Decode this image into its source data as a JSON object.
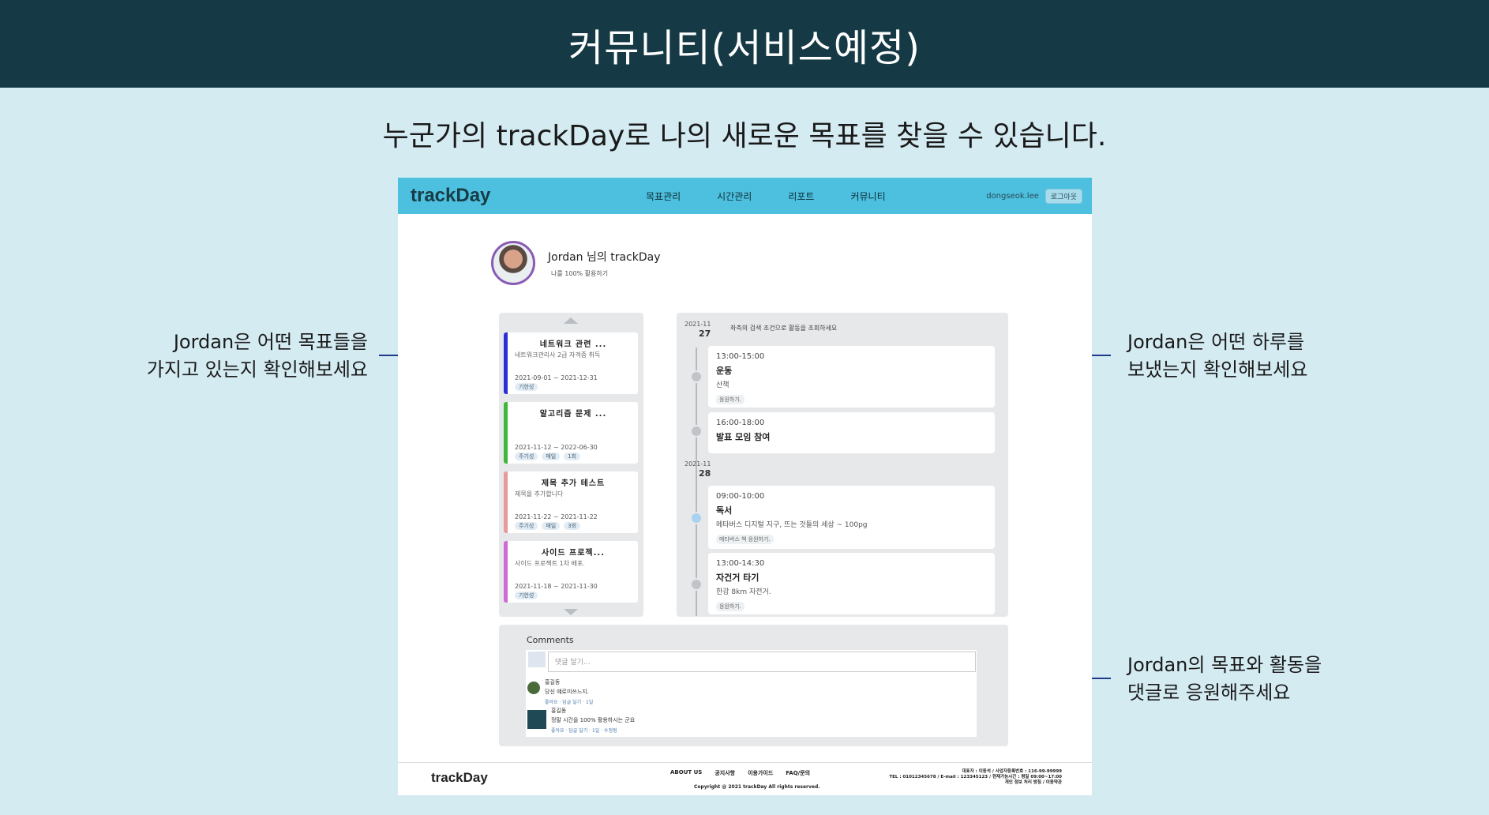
{
  "banner": {
    "title": "커뮤니티(서비스예정)"
  },
  "subtitle": "누군가의 trackDay로 나의 새로운 목표를 찾을 수 있습니다.",
  "annotations": {
    "goals": [
      "Jordan은 어떤 목표들을",
      "가지고 있는지 확인해보세요"
    ],
    "day": [
      "Jordan은 어떤 하루를",
      "보냈는지 확인해보세요"
    ],
    "comments": [
      "Jordan의 목표와 활동을",
      "댓글로 응원해주세요"
    ]
  },
  "app": {
    "logo": "trackDay",
    "menu": [
      "목표관리",
      "시간관리",
      "리포트",
      "커뮤니티"
    ],
    "username": "dongseok.lee",
    "logout": "로그아웃",
    "profile": {
      "name": "Jordan 님의 trackDay",
      "tagline": "나를 100% 활용하기"
    },
    "goals": [
      {
        "title": "네트워크 관련 ...",
        "desc": "네트워크관리사 2급 자격증 취득",
        "date": "2021-09-01 ~ 2021-12-31",
        "tags": [
          "기한성"
        ],
        "color": "#2d2fd6"
      },
      {
        "title": "알고리즘 문제 ...",
        "desc": "",
        "date": "2021-11-12 ~ 2022-06-30",
        "tags": [
          "주기성",
          "매일",
          "1회"
        ],
        "color": "#3fb83a"
      },
      {
        "title": "제목 추가 테스트",
        "desc": "제목을 추가합니다",
        "date": "2021-11-22 ~ 2021-11-22",
        "tags": [
          "주기성",
          "매일",
          "3회"
        ],
        "color": "#e89a9a"
      },
      {
        "title": "사이드 프로젝...",
        "desc": "사이드 프로젝트 1차 배포.",
        "date": "2021-11-18 ~ 2021-11-30",
        "tags": [
          "기한성"
        ],
        "color": "#d06ad4"
      }
    ],
    "timeline": {
      "hint": "좌측의 검색 조건으로 활동을 조회하세요",
      "days": [
        {
          "month": "2021-11",
          "day": "27"
        },
        {
          "month": "2021-11",
          "day": "28"
        }
      ],
      "entries": [
        {
          "time": "13:00-15:00",
          "title": "운동",
          "desc": "산책",
          "cheer": "응원하기."
        },
        {
          "time": "16:00-18:00",
          "title": "발표 모임 참여",
          "desc": "",
          "cheer": ""
        },
        {
          "time": "09:00-10:00",
          "title": "독서",
          "desc": "메타버스 디지털 지구, 뜨는 것들의 세상 ~ 100pg",
          "cheer": "메타버스 책 응원하기."
        },
        {
          "time": "13:00-14:30",
          "title": "자건거 타기",
          "desc": "한강 8km 자전거.",
          "cheer": "응원하기."
        }
      ]
    },
    "comments": {
      "heading": "Comments",
      "placeholder": "댓글 달기...",
      "items": [
        {
          "name": "홍길동",
          "text": "당신 얘로미쓰느지.",
          "actions": "좋아요 · 답글 달기 · 1일"
        },
        {
          "name": "홍길동",
          "text": "정말 시간을 100% 활용하시는 군요",
          "actions": "좋아요 · 답글 달기 · 1일 · 수정됨"
        }
      ]
    },
    "footer": {
      "logo": "trackDay",
      "links": [
        "ABOUT US",
        "공지사항",
        "이용가이드",
        "FAQ/문의"
      ],
      "copyright": "Copyright @ 2021 trackDay All rights reserved.",
      "info": [
        "대표자 : 이동석 / 사업자등록번호 : 116-99-99999",
        "TEL : 01012345678 / E-mail : 123345123 / 현재가능시간 : 평일 09:00~17:00",
        "개인 정보 처리 방침 / 이용약관"
      ]
    }
  }
}
